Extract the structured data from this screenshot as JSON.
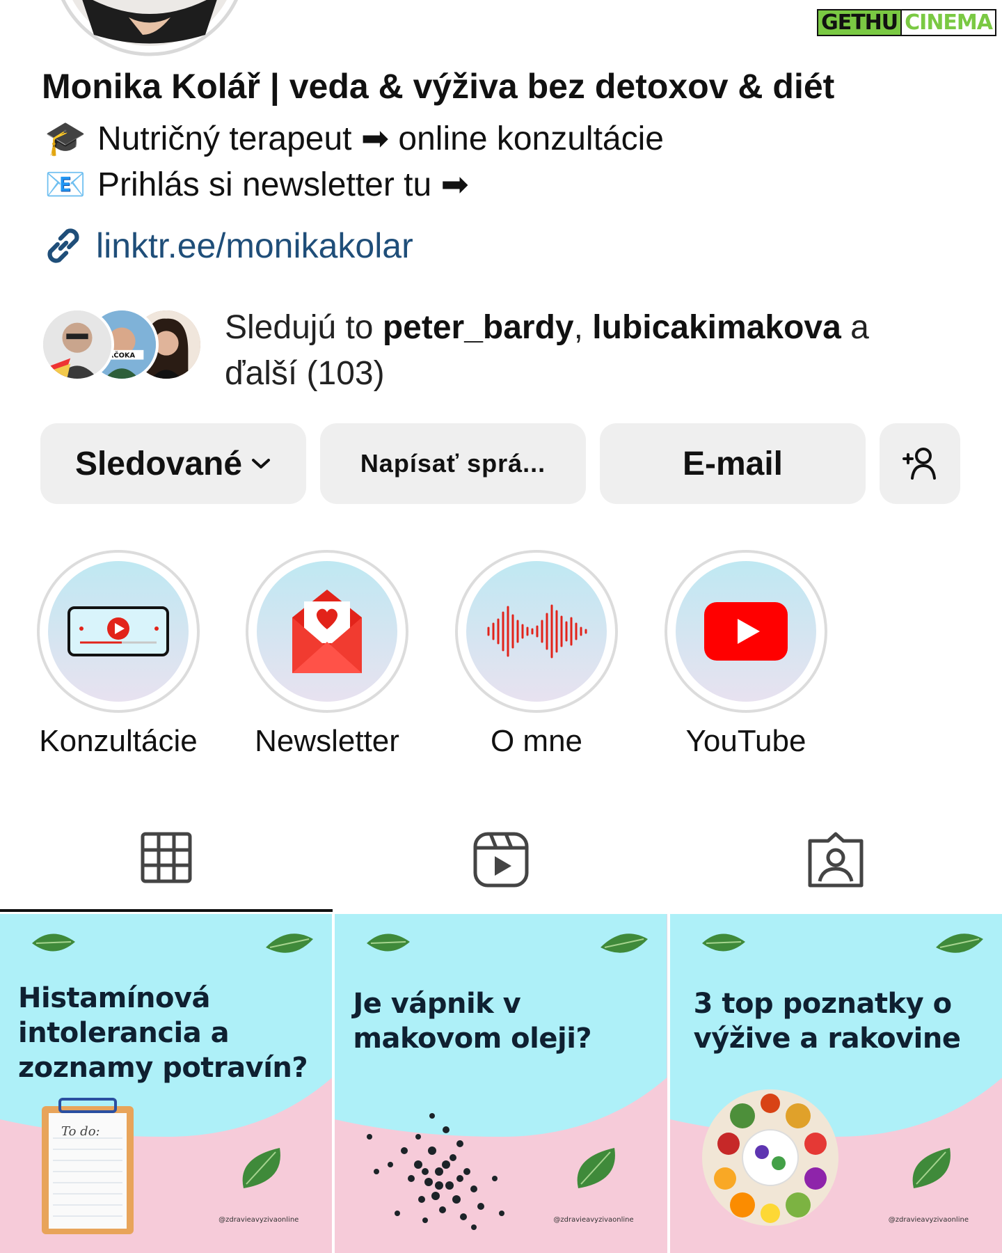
{
  "watermark": {
    "part1": "GETHU",
    "part2": "CINEMA"
  },
  "profile": {
    "name": "Monika Kolář | veda & výživa bez detoxov & diét",
    "bio": [
      {
        "emoji": "🎓",
        "text": "Nutričný terapeut ➡ online konzultácie"
      },
      {
        "emoji": "📧",
        "text": "Prihlás si newsletter tu ➡"
      }
    ],
    "link": "linktr.ee/monikakolar"
  },
  "followed_by": {
    "prefix": "Sledujú to ",
    "user1": "peter_bardy",
    "separator": ", ",
    "user2": "lubicakimakova",
    "suffix": " a ďalší (103)",
    "avatar_badge": "RČOKA"
  },
  "buttons": {
    "follow": "Sledované",
    "message": "Napísať sprá...",
    "email": "E-mail"
  },
  "highlights": [
    {
      "label": "Konzultácie",
      "icon": "video-player-icon"
    },
    {
      "label": "Newsletter",
      "icon": "envelope-heart-icon"
    },
    {
      "label": "O mne",
      "icon": "soundwave-icon"
    },
    {
      "label": "YouTube",
      "icon": "youtube-icon"
    }
  ],
  "tabs": [
    {
      "icon": "grid-icon",
      "active": true
    },
    {
      "icon": "reels-icon",
      "active": false
    },
    {
      "icon": "tagged-icon",
      "active": false
    }
  ],
  "posts": [
    {
      "title_lines": [
        "Histamínová",
        "intolerancia a",
        "zoznamy potravín?"
      ],
      "note": "To do:",
      "handle": "@zdravieavyzivaonline"
    },
    {
      "title_lines": [
        "Je vápnik v",
        "makovom oleji?"
      ],
      "handle": "@zdravieavyzivaonline"
    },
    {
      "title_lines": [
        "3 top poznatky o",
        "výžive a rakovine"
      ],
      "handle": "@zdravieavyzivaonline"
    }
  ],
  "colors": {
    "post_top": "#aef0f8",
    "post_bottom": "#f6cbd9",
    "link": "#1f4e79",
    "button_bg": "#efefef",
    "youtube_red": "#ff0000"
  }
}
